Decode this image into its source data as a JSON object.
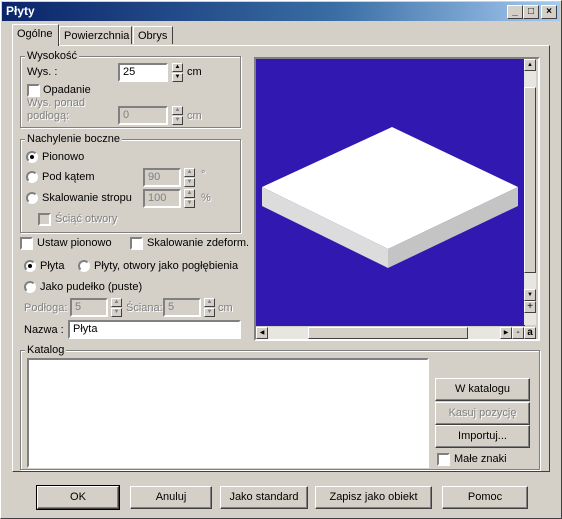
{
  "window": {
    "title": "Płyty",
    "min_label": "_",
    "max_label": "□",
    "close_label": "×"
  },
  "tabs": [
    {
      "label": "Ogólne",
      "active": true
    },
    {
      "label": "Powierzchnia",
      "active": false
    },
    {
      "label": "Obrys",
      "active": false
    }
  ],
  "height_group": {
    "title": "Wysokość",
    "height_label": "Wys. :",
    "height_value": "25",
    "height_unit": "cm",
    "falling_label": "Opadanie",
    "falling_checked": false,
    "above_floor_label_1": "Wys. ponad",
    "above_floor_label_2": "podłogą:",
    "above_floor_value": "0",
    "above_floor_unit": "cm"
  },
  "tilt_group": {
    "title": "Nachylenie boczne",
    "vertical_label": "Pionowo",
    "angle_label": "Pod kątem",
    "angle_value": "90",
    "angle_unit": "°",
    "scale_label": "Skalowanie stropu",
    "scale_value": "100",
    "scale_unit": "%",
    "bevel_label": "Ściąć otwory"
  },
  "options": {
    "set_vertical_label": "Ustaw pionowo",
    "scale_deform_label": "Skalowanie zdeform.",
    "plate_label": "Płyta",
    "plate_recess_label": "Płyty, otwory jako pogłębienia",
    "box_label": "Jako pudełko (puste)",
    "floor_label": "Podłoga:",
    "floor_value": "5",
    "wall_label": "Ściana:",
    "wall_value": "5",
    "wall_unit": "cm",
    "name_label": "Nazwa :",
    "name_value": "Płyta"
  },
  "preview": {
    "background": "#3018b0",
    "plus_label": "+",
    "minus_label": "-",
    "a_label": "a"
  },
  "catalog": {
    "title": "Katalog",
    "to_catalog_label": "W katalogu",
    "delete_label": "Kasuj pozycję",
    "import_label": "Importuj...",
    "small_letters_label": "Małe znaki"
  },
  "footer": {
    "ok_label": "OK",
    "cancel_label": "Anuluj",
    "standard_label": "Jako standard",
    "save_object_label": "Zapisz jako obiekt",
    "help_label": "Pomoc"
  }
}
